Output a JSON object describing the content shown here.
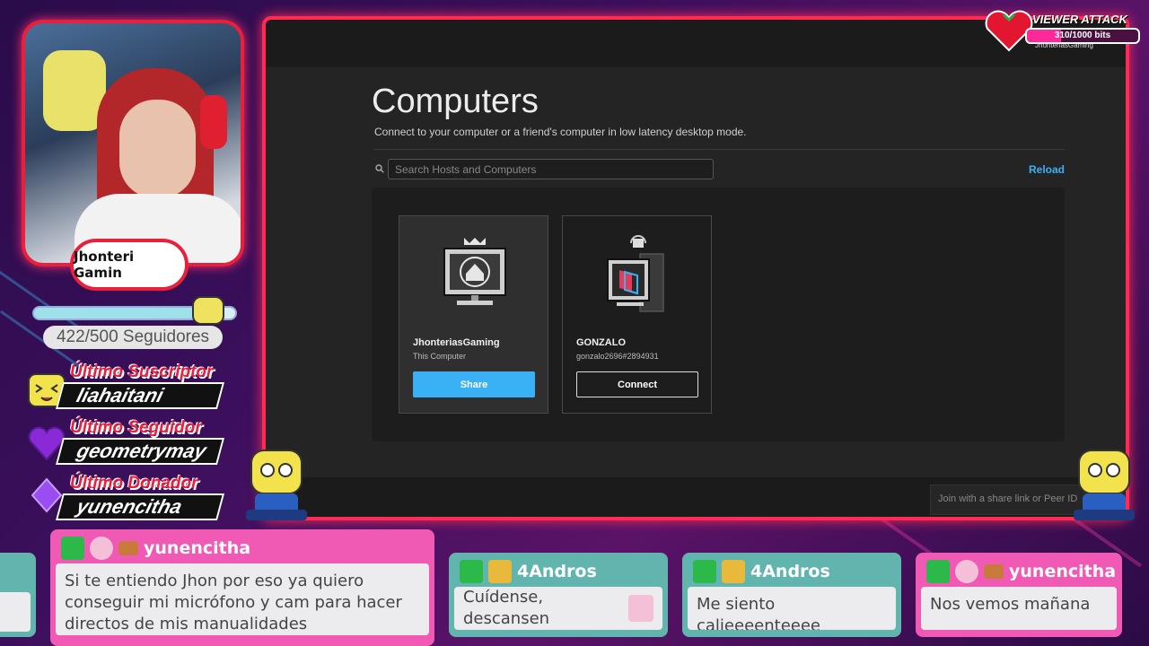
{
  "overlay": {
    "followers": {
      "text": "422/500 Seguidores",
      "current": 422,
      "goal": 500
    },
    "channel_logo": "Jhonteri Gamin",
    "last_subscriber": {
      "label": "Último Suscriptor",
      "name": "liahaitani"
    },
    "last_follower": {
      "label": "Último Seguidor",
      "name": "geometrymay"
    },
    "last_donor": {
      "label": "Último Donador",
      "name": "yunencitha"
    },
    "viewer_attack": {
      "title": "VIEWER ATTACK",
      "progress_text": "310/1000 bits",
      "progress": 0.31,
      "subtitle": "JhonteriasGaming"
    }
  },
  "app": {
    "title": "Computers",
    "subtitle": "Connect to your computer or a friend's computer in low latency desktop mode.",
    "search": {
      "placeholder": "Search Hosts and Computers",
      "value": ""
    },
    "reload_label": "Reload",
    "computers": [
      {
        "name": "JhonteriasGaming",
        "sub": "This Computer",
        "action": "Share"
      },
      {
        "name": "GONZALO",
        "sub": "gonzalo2696#2894931",
        "action": "Connect"
      }
    ],
    "join_placeholder": "Join with a share link or Peer ID"
  },
  "chat": [
    {
      "user": "",
      "message": ""
    },
    {
      "user": "yunencitha",
      "message": "Si te entiendo Jhon por eso ya quiero conseguir mi micrófono y cam para hacer directos de mis manualidades"
    },
    {
      "user": "4Andros",
      "message": "Cuídense, descansen"
    },
    {
      "user": "4Andros",
      "message": "Me siento calieeeenteeee"
    },
    {
      "user": "yunencitha",
      "message": "Nos vemos mañana"
    }
  ],
  "colors": {
    "accent_blue": "#3bb1f5",
    "frame_red": "#ff2a55",
    "chat_pink": "#f05ab4",
    "chat_teal": "#62b5ae"
  }
}
